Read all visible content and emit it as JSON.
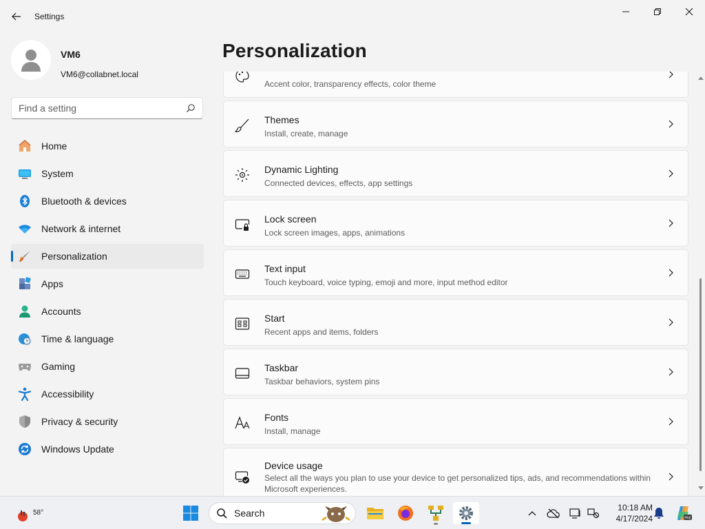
{
  "app": {
    "title": "Settings"
  },
  "profile": {
    "name": "VM6",
    "email": "VM6@collabnet.local"
  },
  "search": {
    "placeholder": "Find a setting"
  },
  "nav": {
    "items": [
      {
        "label": "Home",
        "icon": "home-icon"
      },
      {
        "label": "System",
        "icon": "monitor-icon"
      },
      {
        "label": "Bluetooth & devices",
        "icon": "bluetooth-icon"
      },
      {
        "label": "Network & internet",
        "icon": "wifi-icon"
      },
      {
        "label": "Personalization",
        "icon": "brush-icon",
        "active": true
      },
      {
        "label": "Apps",
        "icon": "apps-icon"
      },
      {
        "label": "Accounts",
        "icon": "person-icon"
      },
      {
        "label": "Time & language",
        "icon": "globe-clock-icon"
      },
      {
        "label": "Gaming",
        "icon": "gamepad-icon"
      },
      {
        "label": "Accessibility",
        "icon": "accessibility-icon"
      },
      {
        "label": "Privacy & security",
        "icon": "shield-icon"
      },
      {
        "label": "Windows Update",
        "icon": "update-icon"
      }
    ]
  },
  "main": {
    "title": "Personalization",
    "cards": [
      {
        "title": "",
        "subtitle": "Accent color, transparency effects, color theme",
        "icon": "palette-icon"
      },
      {
        "title": "Themes",
        "subtitle": "Install, create, manage",
        "icon": "brush-icon"
      },
      {
        "title": "Dynamic Lighting",
        "subtitle": "Connected devices, effects, app settings",
        "icon": "lighting-icon"
      },
      {
        "title": "Lock screen",
        "subtitle": "Lock screen images, apps, animations",
        "icon": "lock-screen-icon"
      },
      {
        "title": "Text input",
        "subtitle": "Touch keyboard, voice typing, emoji and more, input method editor",
        "icon": "keyboard-icon"
      },
      {
        "title": "Start",
        "subtitle": "Recent apps and items, folders",
        "icon": "start-icon"
      },
      {
        "title": "Taskbar",
        "subtitle": "Taskbar behaviors, system pins",
        "icon": "taskbar-icon"
      },
      {
        "title": "Fonts",
        "subtitle": "Install, manage",
        "icon": "fonts-icon"
      },
      {
        "title": "Device usage",
        "subtitle": "Select all the ways you plan to use your device to get personalized tips, ads, and recommendations within Microsoft experiences.",
        "icon": "device-usage-icon"
      }
    ]
  },
  "taskbar": {
    "weather_temp": "58°",
    "search_label": "Search",
    "time": "10:18 AM",
    "date": "4/17/2024"
  },
  "colors": {
    "accent": "#0067c0",
    "background": "#f3f3f3",
    "card": "#fbfbfb"
  }
}
